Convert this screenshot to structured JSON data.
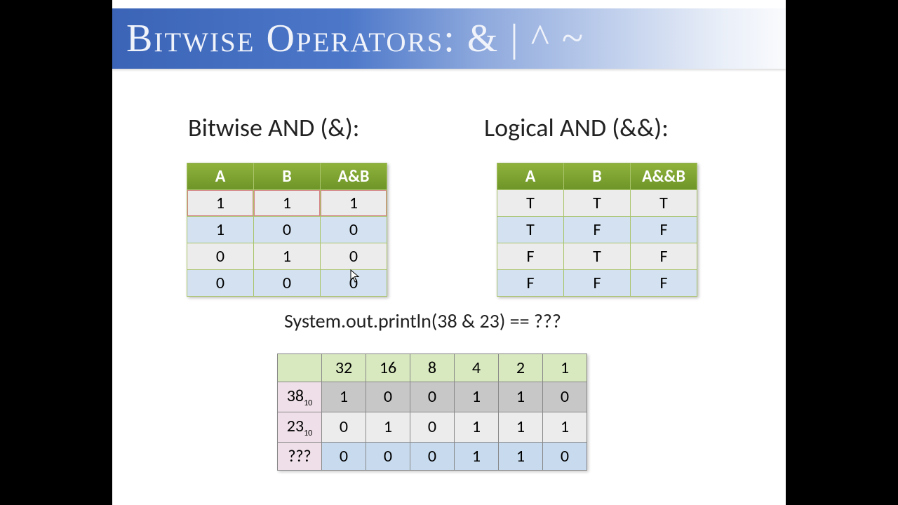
{
  "header": {
    "title": "Bitwise Operators: & | ^ ~"
  },
  "sections": {
    "bitwise_title": "Bitwise AND (&):",
    "logical_title": "Logical AND (&&):"
  },
  "bitwise_table": {
    "headers": [
      "A",
      "B",
      "A&B"
    ],
    "rows": [
      [
        "1",
        "1",
        "1"
      ],
      [
        "1",
        "0",
        "0"
      ],
      [
        "0",
        "1",
        "0"
      ],
      [
        "0",
        "0",
        "0"
      ]
    ]
  },
  "logical_table": {
    "headers": [
      "A",
      "B",
      "A&&B"
    ],
    "rows": [
      [
        "T",
        "T",
        "T"
      ],
      [
        "T",
        "F",
        "F"
      ],
      [
        "F",
        "T",
        "F"
      ],
      [
        "F",
        "F",
        "F"
      ]
    ]
  },
  "code_line": "System.out.println(38 & 23)  == ???",
  "binary_table": {
    "place_values": [
      "32",
      "16",
      "8",
      "4",
      "2",
      "1"
    ],
    "row_labels": {
      "a": "38",
      "a_sub": "10",
      "b": "23",
      "b_sub": "10",
      "result": "???"
    },
    "rows": {
      "a": [
        "1",
        "0",
        "0",
        "1",
        "1",
        "0"
      ],
      "b": [
        "0",
        "1",
        "0",
        "1",
        "1",
        "1"
      ],
      "result": [
        "0",
        "0",
        "0",
        "1",
        "1",
        "0"
      ]
    }
  }
}
